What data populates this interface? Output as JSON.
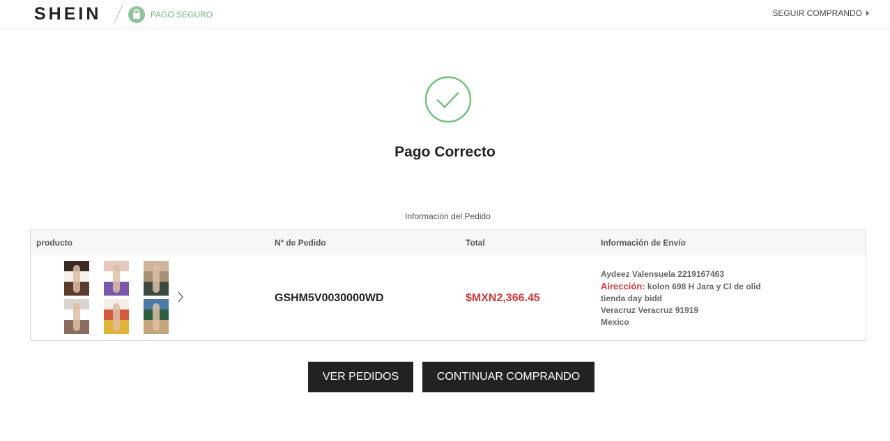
{
  "header": {
    "logo": "SHEIN",
    "secure_label": "PAGO SEGURO",
    "continue_link": "SEGUIR COMPRANDO"
  },
  "status": {
    "title": "Pago Correcto"
  },
  "order_section": {
    "label": "Información del Pedido",
    "columns": [
      "producto",
      "Nº de Pedido",
      "Total",
      "Información de Envío"
    ],
    "order_number": "GSHM5V0030000WD",
    "total": "$MXN2,366.45",
    "shipping": {
      "name_phone": "Aydeez Valensuela 2219167463",
      "address_label": "Airección:",
      "address_line1": "kolon 698 H Jara y Cl de olid",
      "address_line2": "tienda day bidd",
      "city_line": "Veracruz Veracruz 91919",
      "country": "Mexico"
    },
    "products": [
      {
        "name": "product-thumb-1",
        "colors": [
          "#3b2a25",
          "#f4f1ec",
          "#5a3b2e"
        ]
      },
      {
        "name": "product-thumb-2",
        "colors": [
          "#e7c7c0",
          "#ffffff",
          "#7a59a8"
        ]
      },
      {
        "name": "product-thumb-3",
        "colors": [
          "#cdb49a",
          "#a88f77",
          "#3c4a3f"
        ]
      },
      {
        "name": "product-thumb-4",
        "colors": [
          "#d9d4cf",
          "#ffffff",
          "#8a6d5e"
        ]
      },
      {
        "name": "product-thumb-5",
        "colors": [
          "#f3eee6",
          "#d35a3c",
          "#e0b33b"
        ]
      },
      {
        "name": "product-thumb-6",
        "colors": [
          "#4c7aa8",
          "#2d5e3e",
          "#c7a57b"
        ]
      }
    ]
  },
  "actions": {
    "view_orders": "VER PEDIDOS",
    "continue_shopping": "CONTINUAR COMPRANDO"
  },
  "colors": {
    "accent_green": "#72b17e",
    "price_red": "#d0393b",
    "button_bg": "#222222"
  }
}
